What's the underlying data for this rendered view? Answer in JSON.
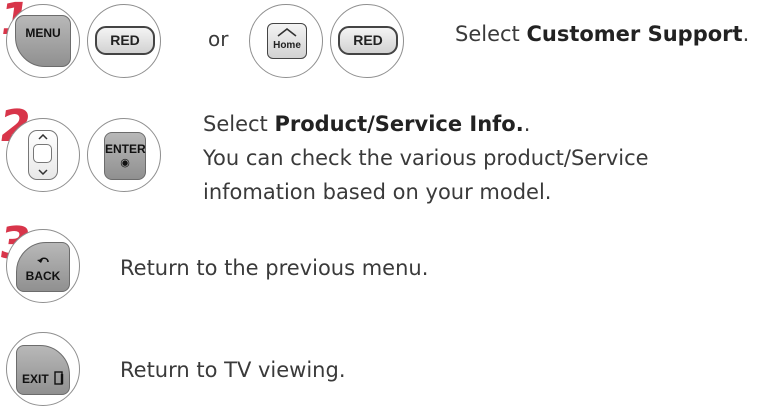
{
  "steps": [
    {
      "number": "1",
      "keys": {
        "menu": "MENU",
        "red_a": "RED",
        "home": "Home",
        "red_b": "RED"
      },
      "or_text": "or",
      "text_prefix": "Select ",
      "text_bold": "Customer Support",
      "text_suffix": "."
    },
    {
      "number": "2",
      "keys": {
        "enter": "ENTER"
      },
      "line1_prefix": "Select ",
      "line1_bold": "Product/Service Info.",
      "line1_suffix": ".",
      "line2": "You can check the various product/Service",
      "line3": "infomation based on your model."
    },
    {
      "number": "3",
      "keys": {
        "back": "BACK"
      },
      "text": "Return to the previous menu."
    },
    {
      "keys": {
        "exit": "EXIT"
      },
      "text": "Return to TV viewing."
    }
  ],
  "colors": {
    "step_number": "#d8354a",
    "text": "#3a3a3a",
    "outline": "#8f8f8f"
  }
}
